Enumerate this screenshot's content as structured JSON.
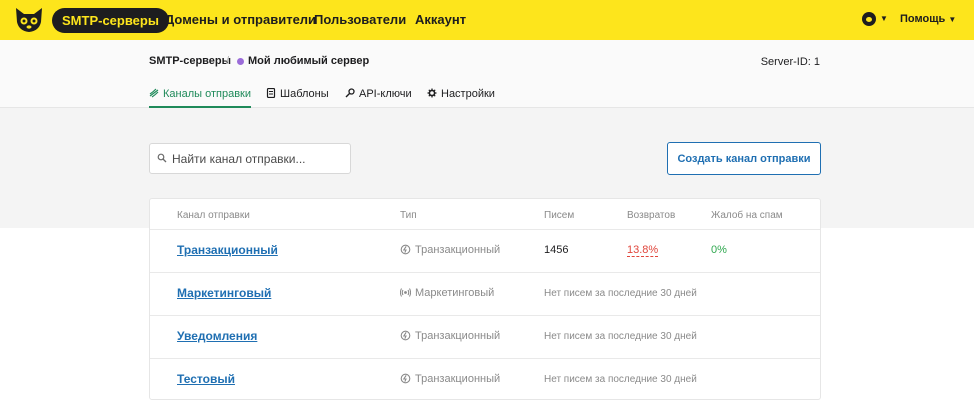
{
  "topbar": {
    "brand_pill": "SMTP-серверы",
    "links": [
      "Домены и отправители",
      "Пользователи",
      "Аккаунт"
    ],
    "help_label": "Помощь"
  },
  "breadcrumb": {
    "root": "SMTP-серверы",
    "current": "Мой любимый сервер",
    "server_id": "Server-ID: 1"
  },
  "tabs": [
    {
      "label": "Каналы отправки",
      "icon": "stream-icon",
      "active": true
    },
    {
      "label": "Шаблоны",
      "icon": "template-icon",
      "active": false
    },
    {
      "label": "API-ключи",
      "icon": "key-icon",
      "active": false
    },
    {
      "label": "Настройки",
      "icon": "gear-icon",
      "active": false
    }
  ],
  "search": {
    "placeholder": "Найти канал отправки..."
  },
  "create_button": "Создать канал отправки",
  "table": {
    "headers": [
      "Канал отправки",
      "Тип",
      "Писем",
      "Возвратов",
      "Жалоб на спам"
    ],
    "rows": [
      {
        "name": "Транзакционный",
        "type": "Транзакционный",
        "emails": "1456",
        "bounces": "13.8%",
        "spam": "0%",
        "empty": ""
      },
      {
        "name": "Маркетинговый",
        "type": "Маркетинговый",
        "emails": "",
        "bounces": "",
        "spam": "",
        "empty": "Нет писем за последние 30 дней"
      },
      {
        "name": "Уведомления",
        "type": "Транзакционный",
        "emails": "",
        "bounces": "",
        "spam": "",
        "empty": "Нет писем за последние 30 дней"
      },
      {
        "name": "Тестовый",
        "type": "Транзакционный",
        "emails": "",
        "bounces": "",
        "spam": "",
        "empty": "Нет писем за последние 30 дней"
      }
    ]
  },
  "colors": {
    "topbar": "#fde51c",
    "accent_green": "#1f8a5a",
    "link_blue": "#1f6fb2",
    "server_dot": "#9b6cd9",
    "bounce_red": "#e0463c",
    "spam_green": "#2fa84f"
  }
}
